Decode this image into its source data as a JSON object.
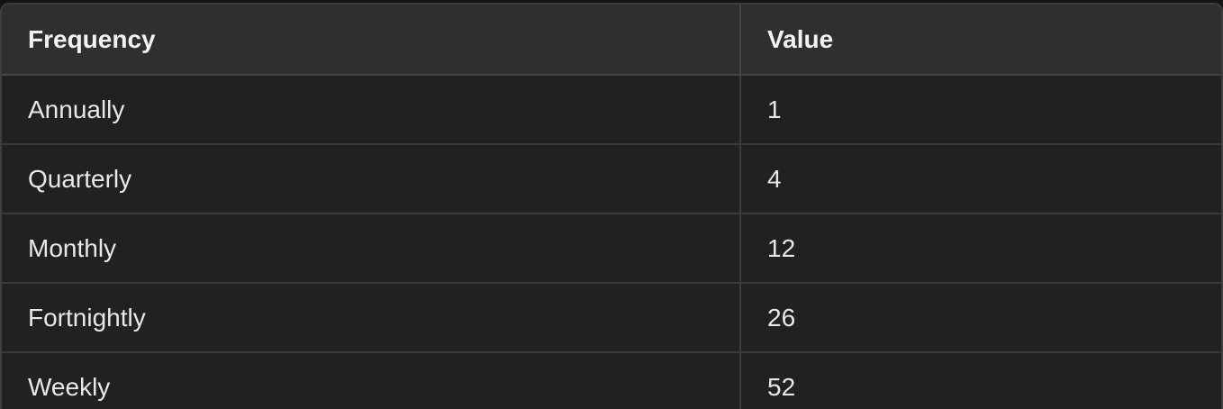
{
  "table": {
    "headers": [
      "Frequency",
      "Value"
    ],
    "rows": [
      [
        "Annually",
        "1"
      ],
      [
        "Quarterly",
        "4"
      ],
      [
        "Monthly",
        "12"
      ],
      [
        "Fortnightly",
        "26"
      ],
      [
        "Weekly",
        "52"
      ]
    ]
  },
  "colors": {
    "page_background": "#141414",
    "table_background": "#212121",
    "header_background": "#2f2f2f",
    "border": "#3e3e3e",
    "text": "#ececec"
  }
}
